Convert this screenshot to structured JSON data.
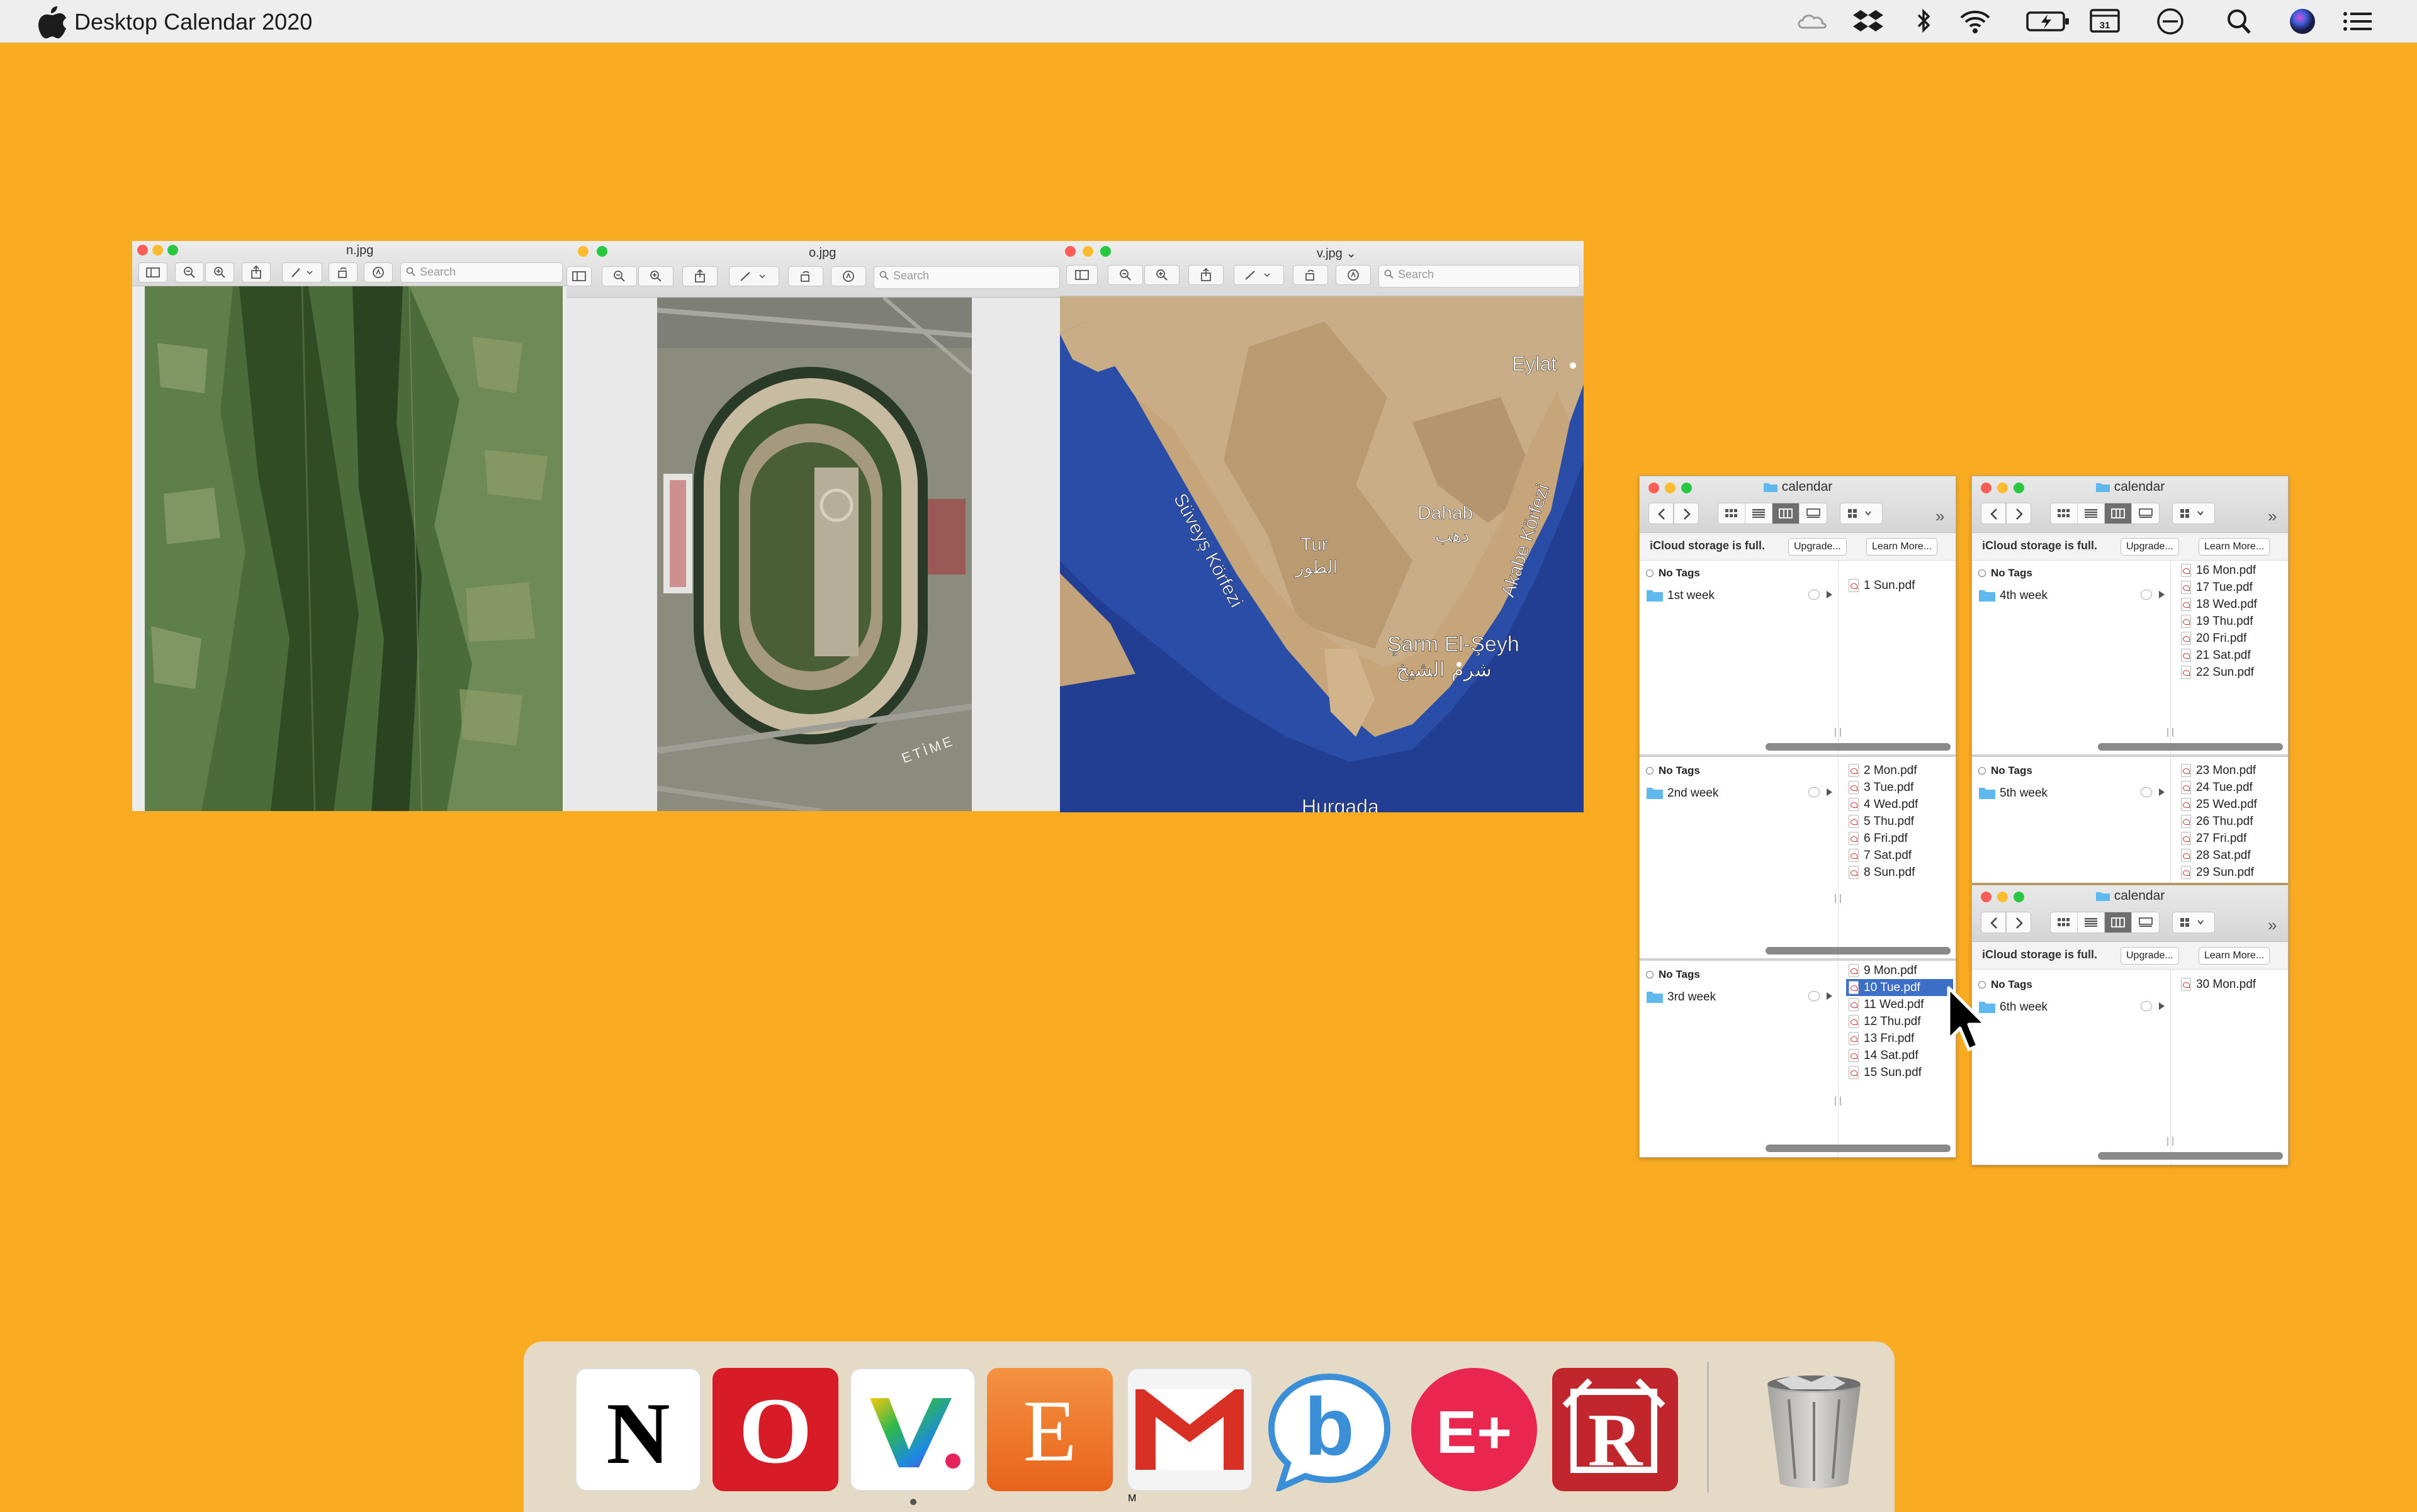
{
  "menubar": {
    "app_name": "Desktop Calendar 2020",
    "status_icons": [
      "creative-cloud-icon",
      "dropbox-icon",
      "bluetooth-icon",
      "wifi-icon",
      "battery-charging-icon",
      "screen-mirroring-icon",
      "do-not-disturb-icon",
      "spotlight-search-icon",
      "siri-icon",
      "notification-center-icon"
    ]
  },
  "preview_windows": [
    {
      "title": "n.jpg",
      "search_placeholder": "Search",
      "image": "aerial-forest-valley"
    },
    {
      "title": "o.jpg",
      "search_placeholder": "Search",
      "image": "aerial-racetrack",
      "map_label": "ETİME"
    },
    {
      "title": "v.jpg",
      "search_placeholder": "Search",
      "image": "satellite-sinai-map",
      "map_labels": {
        "eylat": "Eylat",
        "suveys": "Süveyş Körfezi",
        "akabe": "Akabe Körfezi",
        "dahab": "Dahab",
        "dahab_ar": "دهب",
        "tur": "Tur",
        "tur_ar": "الطور",
        "sarm": "Şarm El-Şeyh",
        "sarm_ar": "شرم الشيخ",
        "hurgada": "Hurgada"
      }
    }
  ],
  "finder": {
    "title": "calendar",
    "icloud_msg": "iCloud storage is full.",
    "upgrade_label": "Upgrade...",
    "learn_more_label": "Learn More...",
    "no_tags": "No Tags",
    "weeks": [
      {
        "folder": "1st week",
        "files": [
          "1 Sun.pdf"
        ]
      },
      {
        "folder": "2nd week",
        "files": [
          "2 Mon.pdf",
          "3 Tue.pdf",
          "4 Wed.pdf",
          "5 Thu.pdf",
          "6 Fri.pdf",
          "7 Sat.pdf",
          "8 Sun.pdf"
        ]
      },
      {
        "folder": "3rd week",
        "files": [
          "9 Mon.pdf",
          "10 Tue.pdf",
          "11 Wed.pdf",
          "12 Thu.pdf",
          "13 Fri.pdf",
          "14 Sat.pdf",
          "15 Sun.pdf"
        ],
        "selected": "10 Tue.pdf"
      },
      {
        "folder": "4th week",
        "files": [
          "16 Mon.pdf",
          "17 Tue.pdf",
          "18 Wed.pdf",
          "19 Thu.pdf",
          "20 Fri.pdf",
          "21 Sat.pdf",
          "22 Sun.pdf"
        ]
      },
      {
        "folder": "5th week",
        "files": [
          "23 Mon.pdf",
          "24 Tue.pdf",
          "25 Wed.pdf",
          "26 Thu.pdf",
          "27 Fri.pdf",
          "28 Sat.pdf",
          "29 Sun.pdf"
        ]
      },
      {
        "folder": "6th week",
        "files": [
          "30 Mon.pdf"
        ]
      }
    ]
  },
  "dock": {
    "apps": [
      {
        "name": "notion-icon",
        "letter": "N",
        "bg": "#FFFFFF",
        "fg": "#111111"
      },
      {
        "name": "opera-icon",
        "letter": "O",
        "bg": "#D71C27",
        "fg": "#FFFFFF"
      },
      {
        "name": "vectorize-icon",
        "letter": "V.",
        "bg": "#FFFFFF",
        "fg": "#E4235A"
      },
      {
        "name": "e-app-icon",
        "letter": "E",
        "bg": "#EF7B28",
        "fg": "#FFFFFF"
      },
      {
        "name": "gmail-icon",
        "letter": "M",
        "bg": "#F4F4F4",
        "fg": "#D93025"
      },
      {
        "name": "b-chat-icon",
        "letter": "b",
        "bg": "#FFFFFF",
        "fg": "#3A8FD8"
      },
      {
        "name": "e-plus-icon",
        "letter": "E+",
        "bg": "#E8264E",
        "fg": "#FFFFFF"
      },
      {
        "name": "r-app-icon",
        "letter": "R",
        "bg": "#C0262C",
        "fg": "#FFFFFF"
      }
    ],
    "trash": "trash-icon"
  },
  "colors": {
    "desktop": "#F9AC22",
    "selection": "#3E6FC8"
  }
}
